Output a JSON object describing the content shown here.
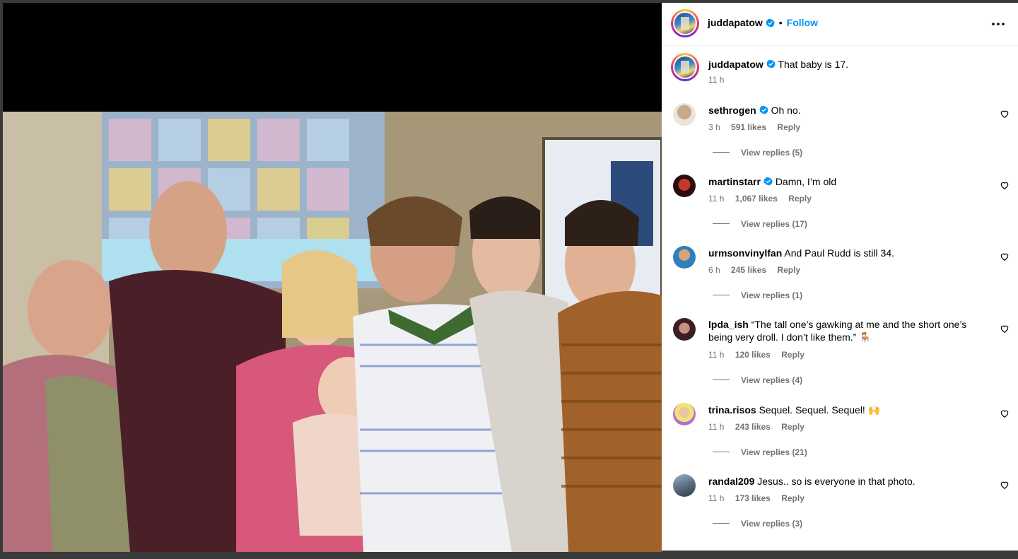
{
  "post": {
    "author": "juddapatow",
    "follow_label": "Follow",
    "dot": "•",
    "caption": "That baby is 17.",
    "caption_time": "11 h"
  },
  "comments": [
    {
      "user": "sethrogen",
      "verified": true,
      "text": "Oh no.",
      "time": "3 h",
      "likes": "591 likes",
      "reply": "Reply",
      "view_replies": "View replies (5)"
    },
    {
      "user": "martinstarr",
      "verified": true,
      "text": "Damn, I’m old",
      "time": "11 h",
      "likes": "1,067 likes",
      "reply": "Reply",
      "view_replies": "View replies (17)"
    },
    {
      "user": "urmsonvinylfan",
      "verified": false,
      "text": "And Paul Rudd is still 34.",
      "time": "6 h",
      "likes": "245 likes",
      "reply": "Reply",
      "view_replies": "View replies (1)"
    },
    {
      "user": "lpda_ish",
      "verified": false,
      "text": "“The tall one’s gawking at me and the short one’s",
      "text2": "being very droll. I don’t like them.” 🪑",
      "time": "11 h",
      "likes": "120 likes",
      "reply": "Reply",
      "view_replies": "View replies (4)"
    },
    {
      "user": "trina.risos",
      "verified": false,
      "text": "Sequel. Sequel. Sequel! 🙌",
      "time": "11 h",
      "likes": "243 likes",
      "reply": "Reply",
      "view_replies": "View replies (21)"
    },
    {
      "user": "randal209",
      "verified": false,
      "text": "Jesus.. so is everyone in that photo.",
      "time": "11 h",
      "likes": "173 likes",
      "reply": "Reply",
      "view_replies": "View replies (3)"
    }
  ],
  "colors": {
    "accent": "#0095f6",
    "secondary_text": "#737373",
    "verified": "#0095f6"
  },
  "icons": {
    "verified": "verified-badge-icon",
    "more": "more-options-icon",
    "like": "heart-icon"
  }
}
